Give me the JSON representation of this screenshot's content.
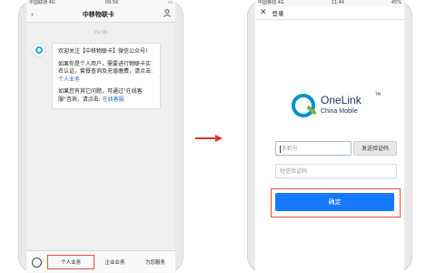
{
  "left_phone": {
    "status": {
      "carrier": "中国联通",
      "network": "4G",
      "time": "09:56"
    },
    "nav": {
      "title": "中移物联卡"
    },
    "chat": {
      "timestamp": "09:56",
      "paragraphs": [
        {
          "text": "欢迎关注【中移物联卡】微信公众号!"
        },
        {
          "text": "如果你是个人用户，需要进行物联卡实名认证，套餐查询及充值缴费，请点击: ",
          "link": "个人业务"
        },
        {
          "text": "如果您有其它问题，可通过\"在线客服\"咨询，请点击: ",
          "link": "在线客服"
        }
      ]
    },
    "menu": {
      "items": [
        "个人业务",
        "企业业务",
        "为您服务"
      ]
    }
  },
  "right_phone": {
    "status": {
      "carrier": "中国移动",
      "network": "4G",
      "time": "11:44",
      "battery": "45%"
    },
    "nav": {
      "title": "登录",
      "close": "✕"
    },
    "logo": {
      "name": "OneLink",
      "tm": "TM",
      "sub": "China Mobile"
    },
    "form": {
      "phone_placeholder": "手机号",
      "send_code_label": "发送验证码",
      "code_placeholder": "短信验证码",
      "confirm_label": "确定"
    }
  },
  "colors": {
    "highlight": "#e64b3c",
    "primary_button": "#1677ff",
    "link": "#2a6bb5",
    "arrow": "#d33333"
  }
}
